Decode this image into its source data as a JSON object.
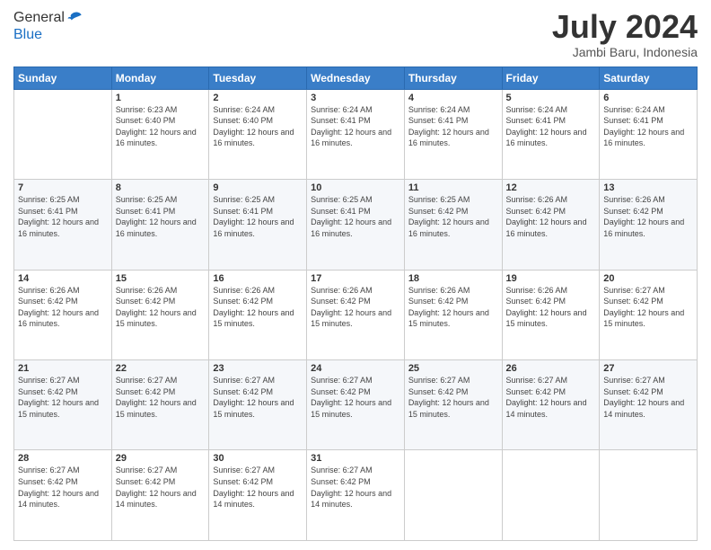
{
  "header": {
    "logo_line1": "General",
    "logo_line2": "Blue",
    "month_title": "July 2024",
    "location": "Jambi Baru, Indonesia"
  },
  "weekdays": [
    "Sunday",
    "Monday",
    "Tuesday",
    "Wednesday",
    "Thursday",
    "Friday",
    "Saturday"
  ],
  "weeks": [
    [
      {
        "day": "",
        "sunrise": "",
        "sunset": "",
        "daylight": ""
      },
      {
        "day": "1",
        "sunrise": "6:23 AM",
        "sunset": "6:40 PM",
        "daylight": "12 hours and 16 minutes."
      },
      {
        "day": "2",
        "sunrise": "6:24 AM",
        "sunset": "6:40 PM",
        "daylight": "12 hours and 16 minutes."
      },
      {
        "day": "3",
        "sunrise": "6:24 AM",
        "sunset": "6:41 PM",
        "daylight": "12 hours and 16 minutes."
      },
      {
        "day": "4",
        "sunrise": "6:24 AM",
        "sunset": "6:41 PM",
        "daylight": "12 hours and 16 minutes."
      },
      {
        "day": "5",
        "sunrise": "6:24 AM",
        "sunset": "6:41 PM",
        "daylight": "12 hours and 16 minutes."
      },
      {
        "day": "6",
        "sunrise": "6:24 AM",
        "sunset": "6:41 PM",
        "daylight": "12 hours and 16 minutes."
      }
    ],
    [
      {
        "day": "7",
        "sunrise": "6:25 AM",
        "sunset": "6:41 PM",
        "daylight": "12 hours and 16 minutes."
      },
      {
        "day": "8",
        "sunrise": "6:25 AM",
        "sunset": "6:41 PM",
        "daylight": "12 hours and 16 minutes."
      },
      {
        "day": "9",
        "sunrise": "6:25 AM",
        "sunset": "6:41 PM",
        "daylight": "12 hours and 16 minutes."
      },
      {
        "day": "10",
        "sunrise": "6:25 AM",
        "sunset": "6:41 PM",
        "daylight": "12 hours and 16 minutes."
      },
      {
        "day": "11",
        "sunrise": "6:25 AM",
        "sunset": "6:42 PM",
        "daylight": "12 hours and 16 minutes."
      },
      {
        "day": "12",
        "sunrise": "6:26 AM",
        "sunset": "6:42 PM",
        "daylight": "12 hours and 16 minutes."
      },
      {
        "day": "13",
        "sunrise": "6:26 AM",
        "sunset": "6:42 PM",
        "daylight": "12 hours and 16 minutes."
      }
    ],
    [
      {
        "day": "14",
        "sunrise": "6:26 AM",
        "sunset": "6:42 PM",
        "daylight": "12 hours and 16 minutes."
      },
      {
        "day": "15",
        "sunrise": "6:26 AM",
        "sunset": "6:42 PM",
        "daylight": "12 hours and 15 minutes."
      },
      {
        "day": "16",
        "sunrise": "6:26 AM",
        "sunset": "6:42 PM",
        "daylight": "12 hours and 15 minutes."
      },
      {
        "day": "17",
        "sunrise": "6:26 AM",
        "sunset": "6:42 PM",
        "daylight": "12 hours and 15 minutes."
      },
      {
        "day": "18",
        "sunrise": "6:26 AM",
        "sunset": "6:42 PM",
        "daylight": "12 hours and 15 minutes."
      },
      {
        "day": "19",
        "sunrise": "6:26 AM",
        "sunset": "6:42 PM",
        "daylight": "12 hours and 15 minutes."
      },
      {
        "day": "20",
        "sunrise": "6:27 AM",
        "sunset": "6:42 PM",
        "daylight": "12 hours and 15 minutes."
      }
    ],
    [
      {
        "day": "21",
        "sunrise": "6:27 AM",
        "sunset": "6:42 PM",
        "daylight": "12 hours and 15 minutes."
      },
      {
        "day": "22",
        "sunrise": "6:27 AM",
        "sunset": "6:42 PM",
        "daylight": "12 hours and 15 minutes."
      },
      {
        "day": "23",
        "sunrise": "6:27 AM",
        "sunset": "6:42 PM",
        "daylight": "12 hours and 15 minutes."
      },
      {
        "day": "24",
        "sunrise": "6:27 AM",
        "sunset": "6:42 PM",
        "daylight": "12 hours and 15 minutes."
      },
      {
        "day": "25",
        "sunrise": "6:27 AM",
        "sunset": "6:42 PM",
        "daylight": "12 hours and 15 minutes."
      },
      {
        "day": "26",
        "sunrise": "6:27 AM",
        "sunset": "6:42 PM",
        "daylight": "12 hours and 14 minutes."
      },
      {
        "day": "27",
        "sunrise": "6:27 AM",
        "sunset": "6:42 PM",
        "daylight": "12 hours and 14 minutes."
      }
    ],
    [
      {
        "day": "28",
        "sunrise": "6:27 AM",
        "sunset": "6:42 PM",
        "daylight": "12 hours and 14 minutes."
      },
      {
        "day": "29",
        "sunrise": "6:27 AM",
        "sunset": "6:42 PM",
        "daylight": "12 hours and 14 minutes."
      },
      {
        "day": "30",
        "sunrise": "6:27 AM",
        "sunset": "6:42 PM",
        "daylight": "12 hours and 14 minutes."
      },
      {
        "day": "31",
        "sunrise": "6:27 AM",
        "sunset": "6:42 PM",
        "daylight": "12 hours and 14 minutes."
      },
      {
        "day": "",
        "sunrise": "",
        "sunset": "",
        "daylight": ""
      },
      {
        "day": "",
        "sunrise": "",
        "sunset": "",
        "daylight": ""
      },
      {
        "day": "",
        "sunrise": "",
        "sunset": "",
        "daylight": ""
      }
    ]
  ],
  "labels": {
    "sunrise_prefix": "Sunrise: ",
    "sunset_prefix": "Sunset: ",
    "daylight_prefix": "Daylight: "
  }
}
